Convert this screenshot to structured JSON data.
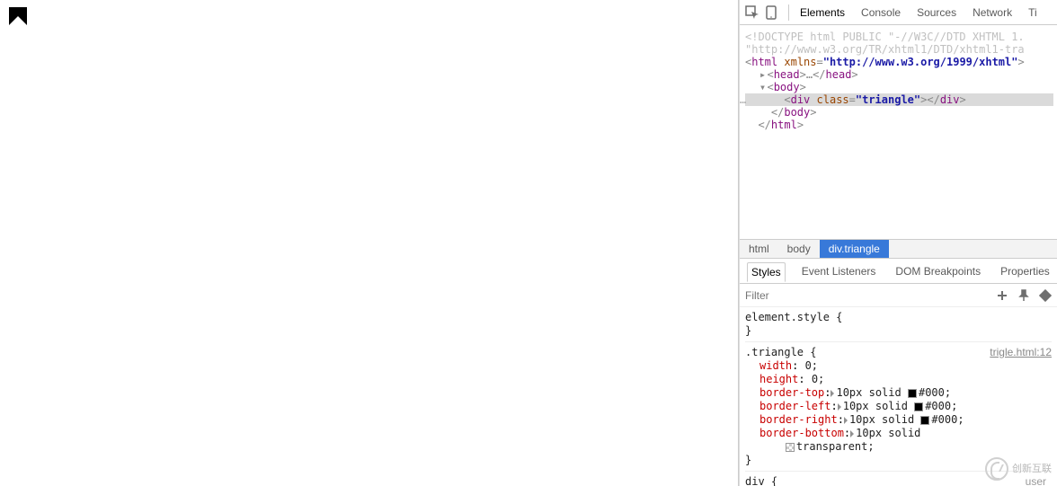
{
  "toolbarTabs": {
    "elements": "Elements",
    "console": "Console",
    "sources": "Sources",
    "network": "Network",
    "timeline": "Ti"
  },
  "dom": {
    "doctypeA": "<!DOCTYPE html PUBLIC \"-//W3C//DTD XHTML 1.",
    "doctypeB": "\"http://www.w3.org/TR/xhtml1/DTD/xhtml1-tra",
    "htmlOpenA": "<",
    "htmlTag": "html",
    "htmlAttrName": "xmlns",
    "htmlAttrEq": "=",
    "htmlAttrVal": "\"http://www.w3.org/1999/xhtml\"",
    "htmlOpenEnd": ">",
    "headOpen": "<",
    "headTag": "head",
    "headEllipsis": "…",
    "headClose1": "</",
    "headClose2": ">",
    "bodyOpen": "<",
    "bodyTag": "body",
    "bodyEnd": ">",
    "divOpen": "<",
    "divTag": "div",
    "divAttrName": "class",
    "divAttrVal": "\"triangle\"",
    "divMidClose": "></",
    "divClose": ">",
    "bodyCloseA": "</",
    "bodyCloseB": ">",
    "htmlCloseA": "</",
    "htmlCloseB": ">"
  },
  "breadcrumbs": {
    "a": "html",
    "b": "body",
    "c": "div.triangle"
  },
  "panel": {
    "styles": "Styles",
    "eventListeners": "Event Listeners",
    "domBreakpoints": "DOM Breakpoints",
    "properties": "Properties"
  },
  "filter": {
    "placeholder": "Filter"
  },
  "rules": {
    "elementStyle": {
      "selector": "element.style",
      "open": " {",
      "close": "}"
    },
    "triangle": {
      "selector": ".triangle",
      "open": " {",
      "close": "}",
      "source": "trigle.html:12",
      "decls": {
        "widthP": "width",
        "widthV": " 0;",
        "heightP": "height",
        "heightV": " 0;",
        "btP": "border-top",
        "btV": "10px solid ",
        "btC": "#000;",
        "blP": "border-left",
        "blV": "10px solid ",
        "blC": "#000;",
        "brP": "border-right",
        "brV": "10px solid ",
        "brC": "#000;",
        "bbP": "border-bottom",
        "bbV": "10px solid",
        "bbC": "transparent;"
      }
    },
    "div": {
      "selector": "div",
      "open": " {",
      "userAgent": "user"
    }
  },
  "watermark": {
    "text": "创新互联"
  }
}
